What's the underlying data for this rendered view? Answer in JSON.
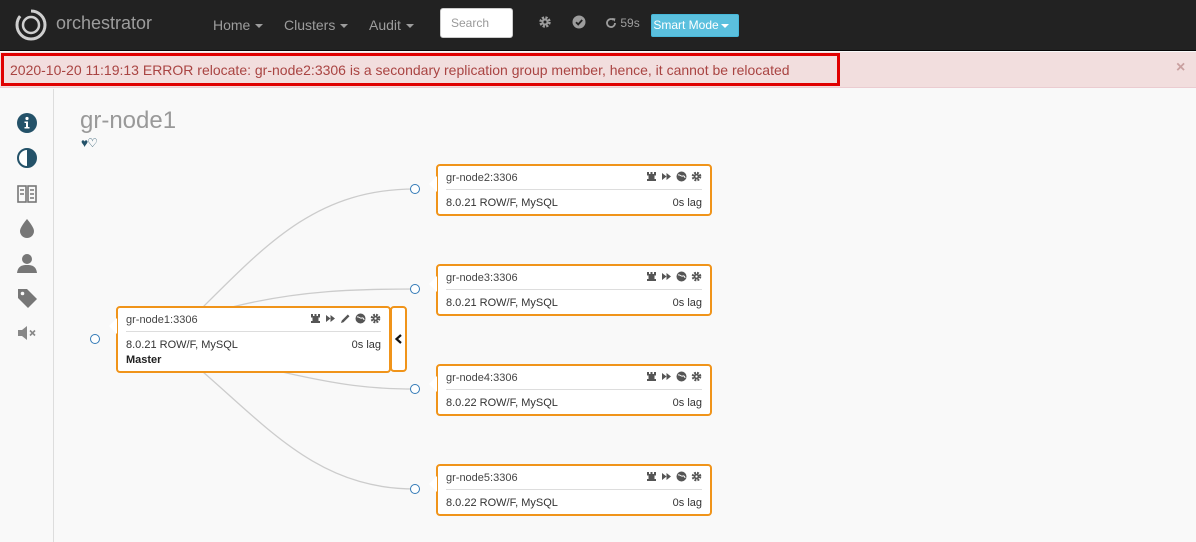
{
  "navbar": {
    "brand": "orchestrator",
    "menu": [
      {
        "label": "Home"
      },
      {
        "label": "Clusters"
      },
      {
        "label": "Audit"
      }
    ],
    "search_placeholder": "Search",
    "refresh_countdown": "59s",
    "smart_mode_label": "Smart Mode"
  },
  "alert": {
    "message": "2020-10-20 11:19:13 ERROR relocate: gr-node2:3306 is a secondary replication group member, hence, it cannot be relocated",
    "close": "×"
  },
  "cluster": {
    "title": "gr-node1",
    "hearts": "♥♡"
  },
  "nodes": {
    "master": {
      "name": "gr-node1:3306",
      "version": "8.0.21 ROW/F, MySQL",
      "lag": "0s lag",
      "role": "Master"
    },
    "replicas": [
      {
        "name": "gr-node2:3306",
        "version": "8.0.21 ROW/F, MySQL",
        "lag": "0s lag"
      },
      {
        "name": "gr-node3:3306",
        "version": "8.0.21 ROW/F, MySQL",
        "lag": "0s lag"
      },
      {
        "name": "gr-node4:3306",
        "version": "8.0.22 ROW/F, MySQL",
        "lag": "0s lag"
      },
      {
        "name": "gr-node5:3306",
        "version": "8.0.22 ROW/F, MySQL",
        "lag": "0s lag"
      }
    ]
  },
  "colors": {
    "navbar_bg": "#222222",
    "alert_bg": "#f2dede",
    "alert_text": "#a94442",
    "alert_highlight": "#e00000",
    "node_border": "#f0941a",
    "smart_mode": "#5bc0de",
    "sidebar_icon": "#245269"
  },
  "sidebar_icons": [
    "info-icon",
    "contrast-icon",
    "compare-icon",
    "tint-icon",
    "user-icon",
    "tag-icon",
    "mute-icon"
  ]
}
